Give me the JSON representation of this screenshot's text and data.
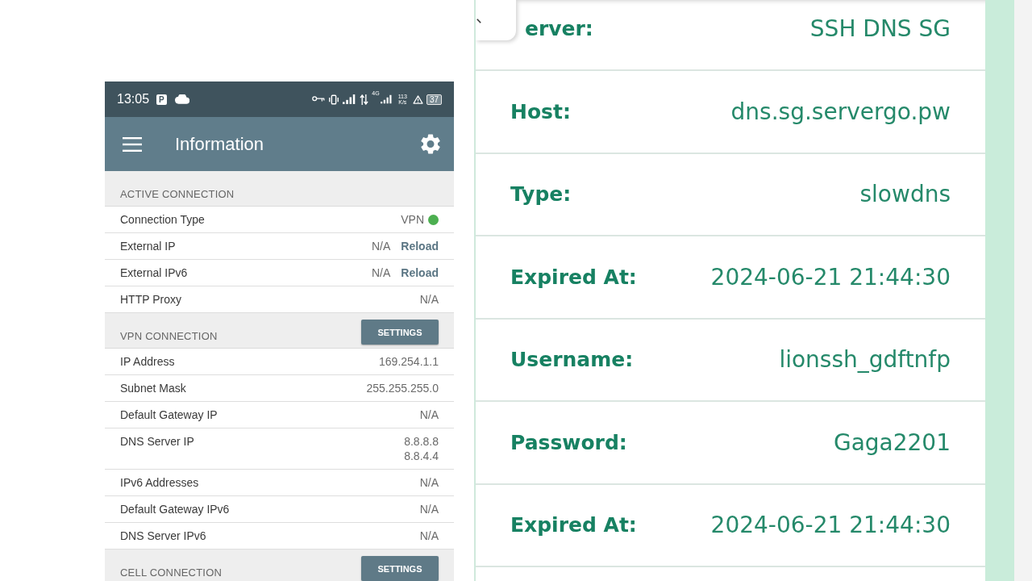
{
  "phone": {
    "status_bar": {
      "time": "13:05",
      "app_badge": "P",
      "network_type": "4G",
      "speed": "113",
      "speed_unit": "K/s",
      "battery": "37"
    },
    "toolbar": {
      "title": "Information"
    },
    "sections": [
      {
        "title": "ACTIVE CONNECTION",
        "rows": [
          {
            "label": "Connection Type",
            "values": [
              "VPN"
            ],
            "color": "#4caf50"
          },
          {
            "label": "External IP",
            "values": [
              "N/A"
            ],
            "action": "Reload"
          },
          {
            "label": "External IPv6",
            "values": [
              "N/A"
            ],
            "action": "Reload"
          },
          {
            "label": "HTTP Proxy",
            "values": [
              "N/A"
            ]
          }
        ]
      },
      {
        "title": "VPN CONNECTION",
        "button": "SETTINGS",
        "rows": [
          {
            "label": "IP Address",
            "values": [
              "169.254.1.1"
            ]
          },
          {
            "label": "Subnet Mask",
            "values": [
              "255.255.255.0"
            ]
          },
          {
            "label": "Default Gateway IP",
            "values": [
              "N/A"
            ]
          },
          {
            "label": "DNS Server IP",
            "values": [
              "8.8.8.8",
              "8.8.4.4"
            ]
          },
          {
            "label": "IPv6 Addresses",
            "values": [
              "N/A"
            ]
          },
          {
            "label": "Default Gateway IPv6",
            "values": [
              "N/A"
            ]
          },
          {
            "label": "DNS Server IPv6",
            "values": [
              "N/A"
            ]
          }
        ]
      },
      {
        "title": "CELL CONNECTION",
        "button": "SETTINGS"
      }
    ]
  },
  "account": {
    "rows": [
      {
        "label": "erver:",
        "value": "SSH DNS SG"
      },
      {
        "label": "Host:",
        "value": "dns.sg.servergo.pw"
      },
      {
        "label": "Type:",
        "value": "slowdns"
      },
      {
        "label": "Expired At:",
        "value": "2024-06-21 21:44:30"
      },
      {
        "label": "Username:",
        "value": "lionssh_gdftnfp"
      },
      {
        "label": "Password:",
        "value": "Gaga2201"
      },
      {
        "label": "Expired At:",
        "value": "2024-06-21 21:44:30"
      }
    ]
  }
}
